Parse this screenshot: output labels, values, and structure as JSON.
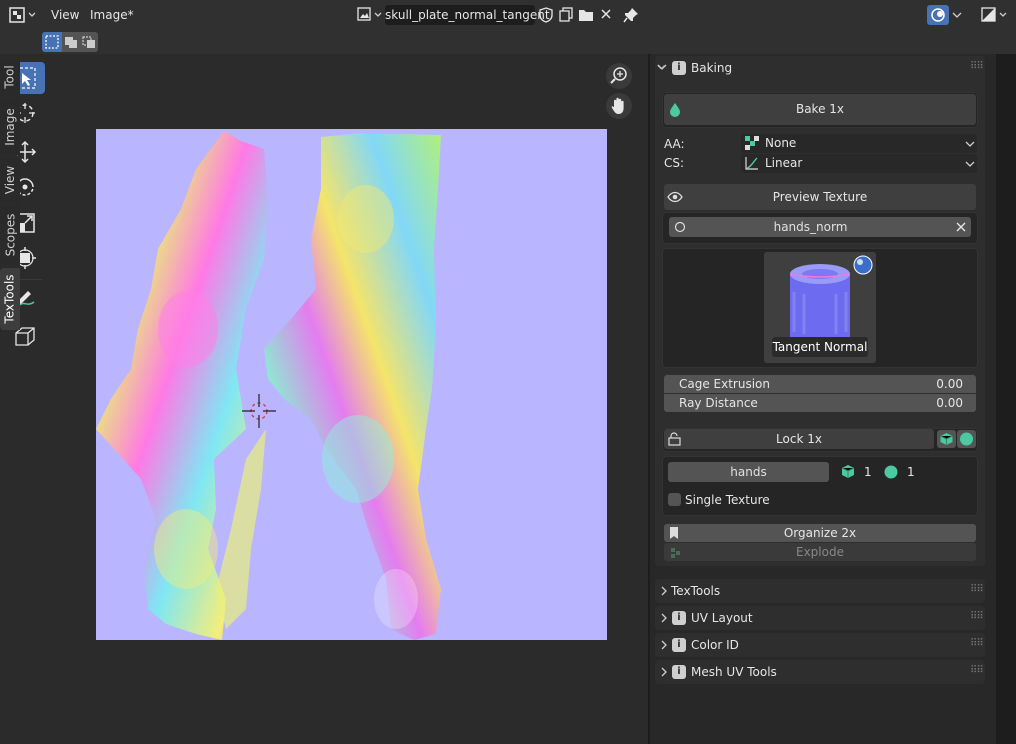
{
  "header": {
    "menus": [
      "View",
      "Image*"
    ],
    "image_name": "skull_plate_normal_tangent"
  },
  "sidebar": {
    "tabs": [
      "Tool",
      "Image",
      "View",
      "Scopes",
      "TexTools"
    ],
    "baking": {
      "title": "Baking",
      "bake_button": "Bake 1x",
      "aa_label": "AA:",
      "aa_value": "None",
      "cs_label": "CS:",
      "cs_value": "Linear",
      "preview_button": "Preview Texture",
      "texture_name": "hands_norm",
      "bake_mode_label": "Tangent Normal",
      "cage_label": "Cage Extrusion",
      "cage_value": "0.00",
      "ray_label": "Ray Distance",
      "ray_value": "0.00",
      "lock_button": "Lock 1x",
      "set_name": "hands",
      "count_a": "1",
      "count_b": "1",
      "single_texture_label": "Single Texture",
      "organize_button": "Organize 2x",
      "explode_button": "Explode"
    },
    "collapsed_panels": [
      "TexTools",
      "UV Layout",
      "Color ID",
      "Mesh UV Tools"
    ]
  },
  "colors": {
    "accent": "#4772b3",
    "canvas_bg": "#b9b5ff",
    "panel_bg": "#2e2e2e"
  }
}
